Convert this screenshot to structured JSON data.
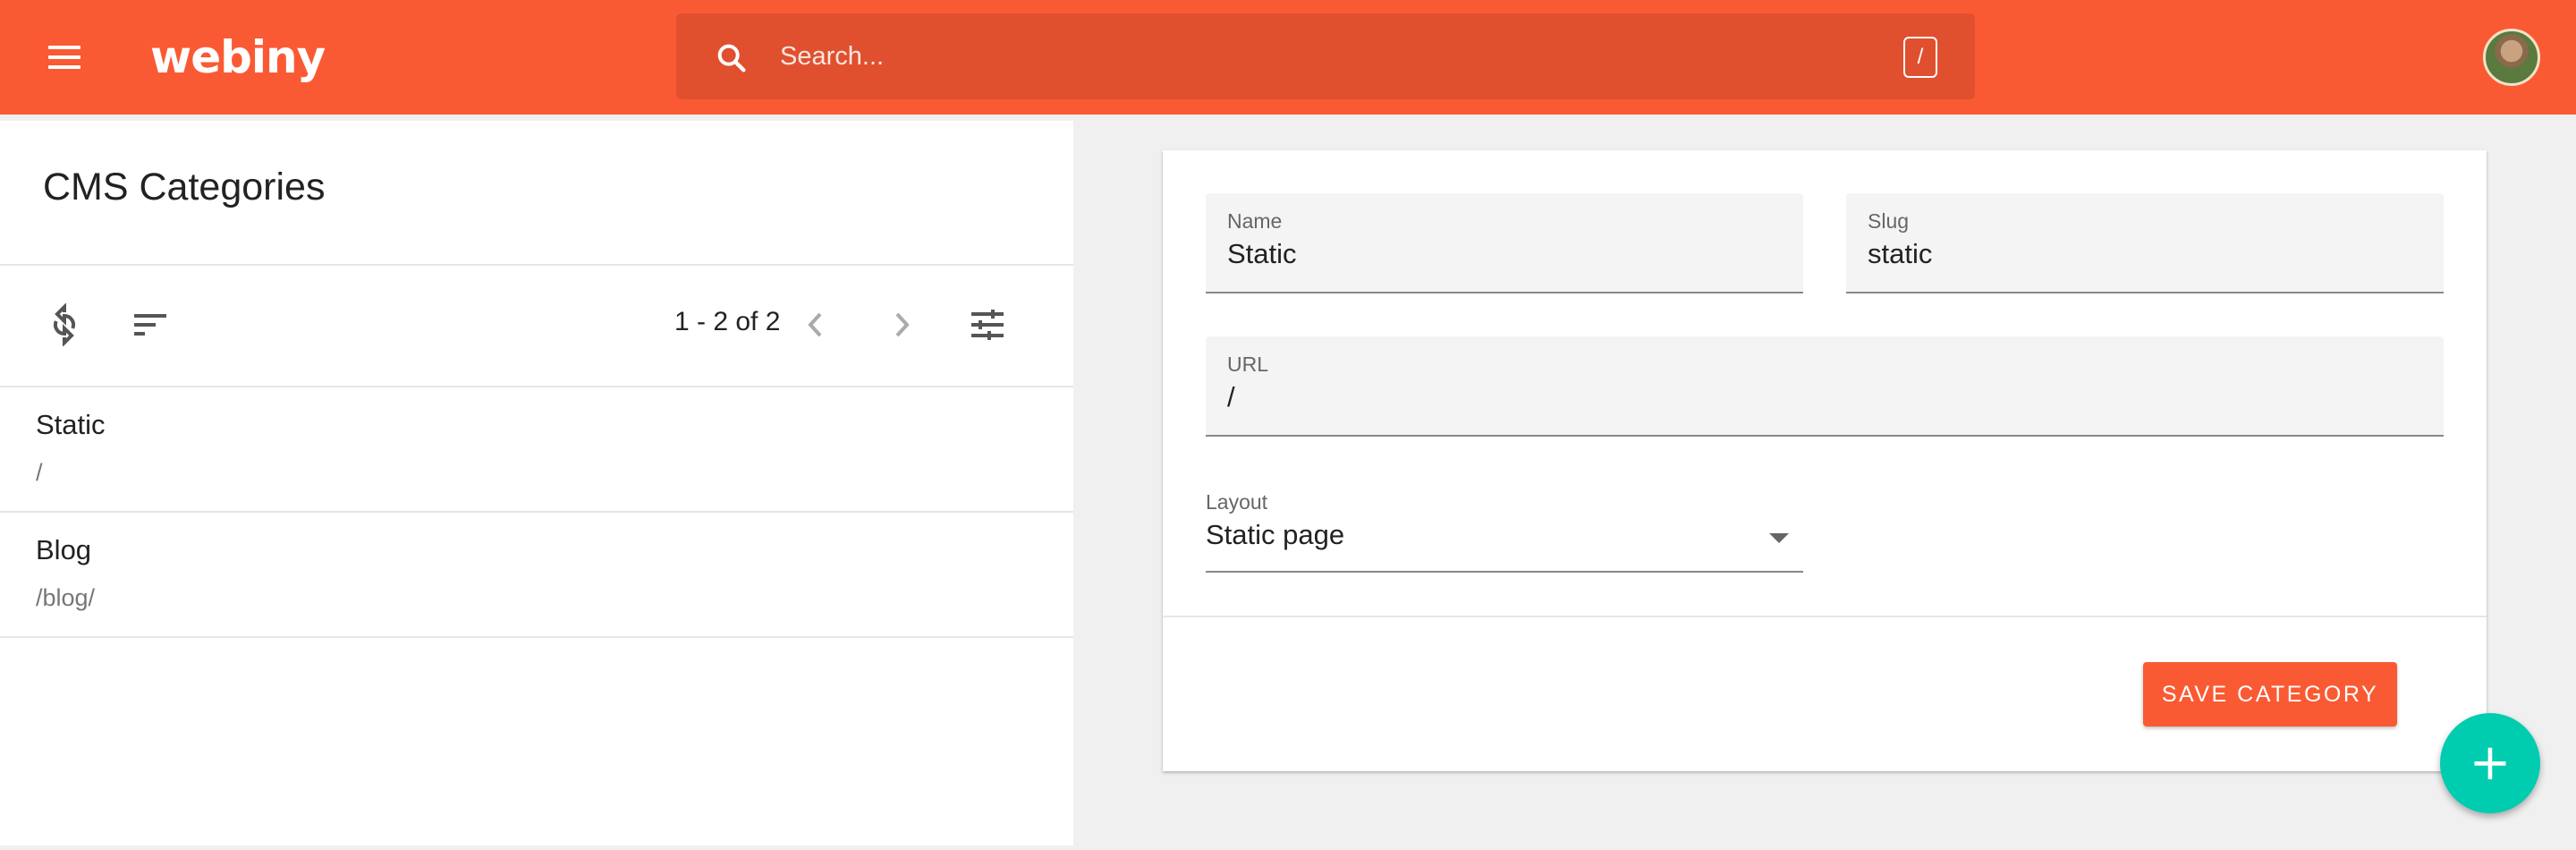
{
  "header": {
    "logo_text": "webiny",
    "search_placeholder": "Search...",
    "search_shortcut": "/",
    "brand_color": "#fa5a33"
  },
  "list_panel": {
    "title": "CMS Categories",
    "pagination": "1 - 2 of 2",
    "items": [
      {
        "name": "Static",
        "url": "/"
      },
      {
        "name": "Blog",
        "url": "/blog/"
      }
    ]
  },
  "form": {
    "name_label": "Name",
    "name_value": "Static",
    "slug_label": "Slug",
    "slug_value": "static",
    "url_label": "URL",
    "url_value": "/",
    "layout_label": "Layout",
    "layout_value": "Static page",
    "save_label": "SAVE CATEGORY"
  },
  "fab": {
    "label": "+",
    "color": "#00ccb0"
  },
  "icons": [
    "menu-icon",
    "search-icon",
    "refresh-icon",
    "sort-icon",
    "chevron-left-icon",
    "chevron-right-icon",
    "filter-settings-icon",
    "dropdown-arrow-icon",
    "add-icon"
  ]
}
